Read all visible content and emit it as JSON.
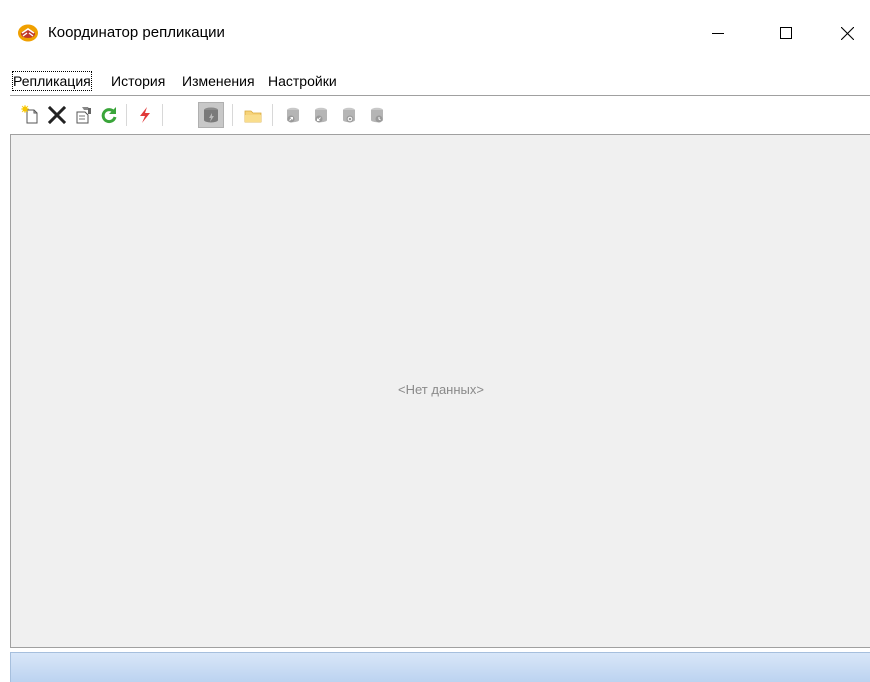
{
  "window": {
    "title": "Координатор репликации"
  },
  "menu": {
    "tabs": [
      {
        "label": "Репликация",
        "active": true
      },
      {
        "label": "История",
        "active": false
      },
      {
        "label": "Изменения",
        "active": false
      },
      {
        "label": "Настройки",
        "active": false
      }
    ]
  },
  "toolbar": {
    "buttons": [
      {
        "icon": "new-document-icon"
      },
      {
        "icon": "delete-x-icon"
      },
      {
        "icon": "properties-icon"
      },
      {
        "icon": "refresh-icon"
      },
      {
        "icon": "lightning-icon"
      },
      {
        "icon": "database-lightning-icon",
        "pressed": true
      },
      {
        "icon": "folder-icon"
      },
      {
        "icon": "database-arrow-up-icon"
      },
      {
        "icon": "database-arrow-down-icon"
      },
      {
        "icon": "database-sync-icon"
      },
      {
        "icon": "database-clock-icon"
      }
    ]
  },
  "content": {
    "empty_text": "<Нет данных>"
  },
  "colors": {
    "accent": "#f0a000",
    "status_bar": "#c6daf3",
    "panel": "#f0f0f0",
    "refresh_green": "#3aa53a",
    "lightning_red": "#e03a3a"
  }
}
